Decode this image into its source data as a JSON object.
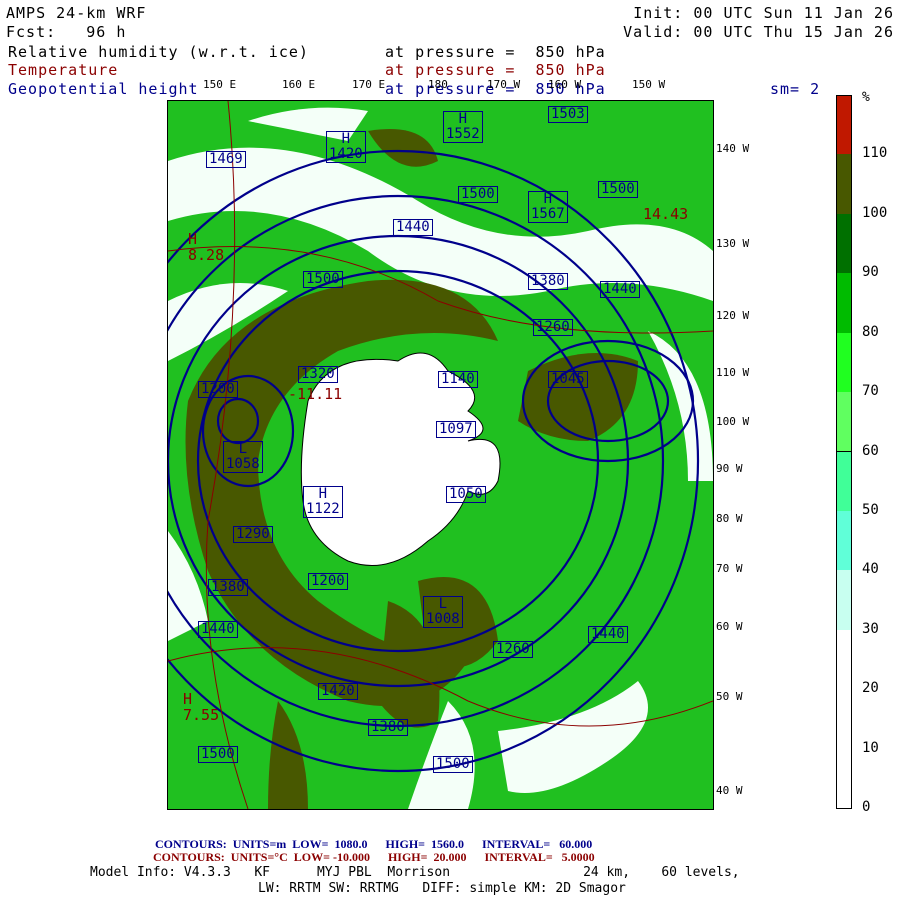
{
  "header": {
    "model": "AMPS 24-km WRF",
    "forecast": "Fcst:   96 h",
    "init": "Init: 00 UTC Sun 11 Jan 26",
    "valid": "Valid: 00 UTC Thu 15 Jan 26",
    "fields": [
      {
        "name": "Relative humidity (w.r.t. ice)",
        "level": "at pressure =  850 hPa",
        "color": "#000000"
      },
      {
        "name": "Temperature",
        "level": "at pressure =  850 hPa",
        "color": "#8b0000"
      },
      {
        "name": "Geopotential height",
        "level": "at pressure =  850 hPa",
        "color": "#00008b"
      }
    ],
    "smoothing": "sm= 2"
  },
  "map": {
    "top_lon_labels": [
      "150 E",
      "160 E",
      "170 E",
      "180",
      "170 W",
      "160 W",
      "150 W"
    ],
    "right_lon_labels": [
      "140 W",
      "130 W",
      "120 W",
      "110 W",
      "100 W",
      "90 W",
      "80 W",
      "70 W",
      "60 W",
      "50 W",
      "40 W"
    ],
    "height_labels": [
      {
        "t": "H\n1552"
      },
      {
        "t": "1503"
      },
      {
        "t": "H\n1420"
      },
      {
        "t": "1469"
      },
      {
        "t": "1500"
      },
      {
        "t": "H\n1567"
      },
      {
        "t": "1500"
      },
      {
        "t": "1440"
      },
      {
        "t": "1380"
      },
      {
        "t": "1440"
      },
      {
        "t": "1500"
      },
      {
        "t": "1320"
      },
      {
        "t": "1260"
      },
      {
        "t": "1200"
      },
      {
        "t": "1045"
      },
      {
        "t": "1140"
      },
      {
        "t": "1097"
      },
      {
        "t": "L\n1058"
      },
      {
        "t": "H\n1122"
      },
      {
        "t": "1050"
      },
      {
        "t": "1200"
      },
      {
        "t": "1290"
      },
      {
        "t": "1380"
      },
      {
        "t": "1440"
      },
      {
        "t": "L\n1008"
      },
      {
        "t": "1260"
      },
      {
        "t": "1440"
      },
      {
        "t": "1420"
      },
      {
        "t": "1380"
      },
      {
        "t": "1500"
      },
      {
        "t": "1500"
      }
    ],
    "temp_labels": [
      "H\n8.28",
      "-11.11",
      "H\n7.55",
      "14.43"
    ]
  },
  "colorbar": {
    "unit": "%",
    "labels": [
      "110",
      "100",
      "90",
      "80",
      "70",
      "60",
      "50",
      "40",
      "30",
      "20",
      "10",
      "0"
    ],
    "colors": [
      "#c01800",
      "#485800",
      "#007000",
      "#00bb00",
      "#20ff20",
      "#60ff60",
      "#40ff98",
      "#60ffd8",
      "#c8fff0",
      "#ffffff",
      "#ffffff",
      "#ffffff",
      "#ffffff"
    ]
  },
  "footer": {
    "height_contours": "CONTOURS:  UNITS=m  LOW=  1080.0      HIGH=  1560.0      INTERVAL=   60.000",
    "temp_contours": "CONTOURS:  UNITS=°C  LOW= -10.000      HIGH=  20.000      INTERVAL=   5.0000",
    "model_info": "Model Info: V4.3.3   KF      MYJ PBL  Morrison                 24 km,    60 levels,",
    "physics": "LW: RRTM SW: RRTMG   DIFF: simple KM: 2D Smagor"
  }
}
